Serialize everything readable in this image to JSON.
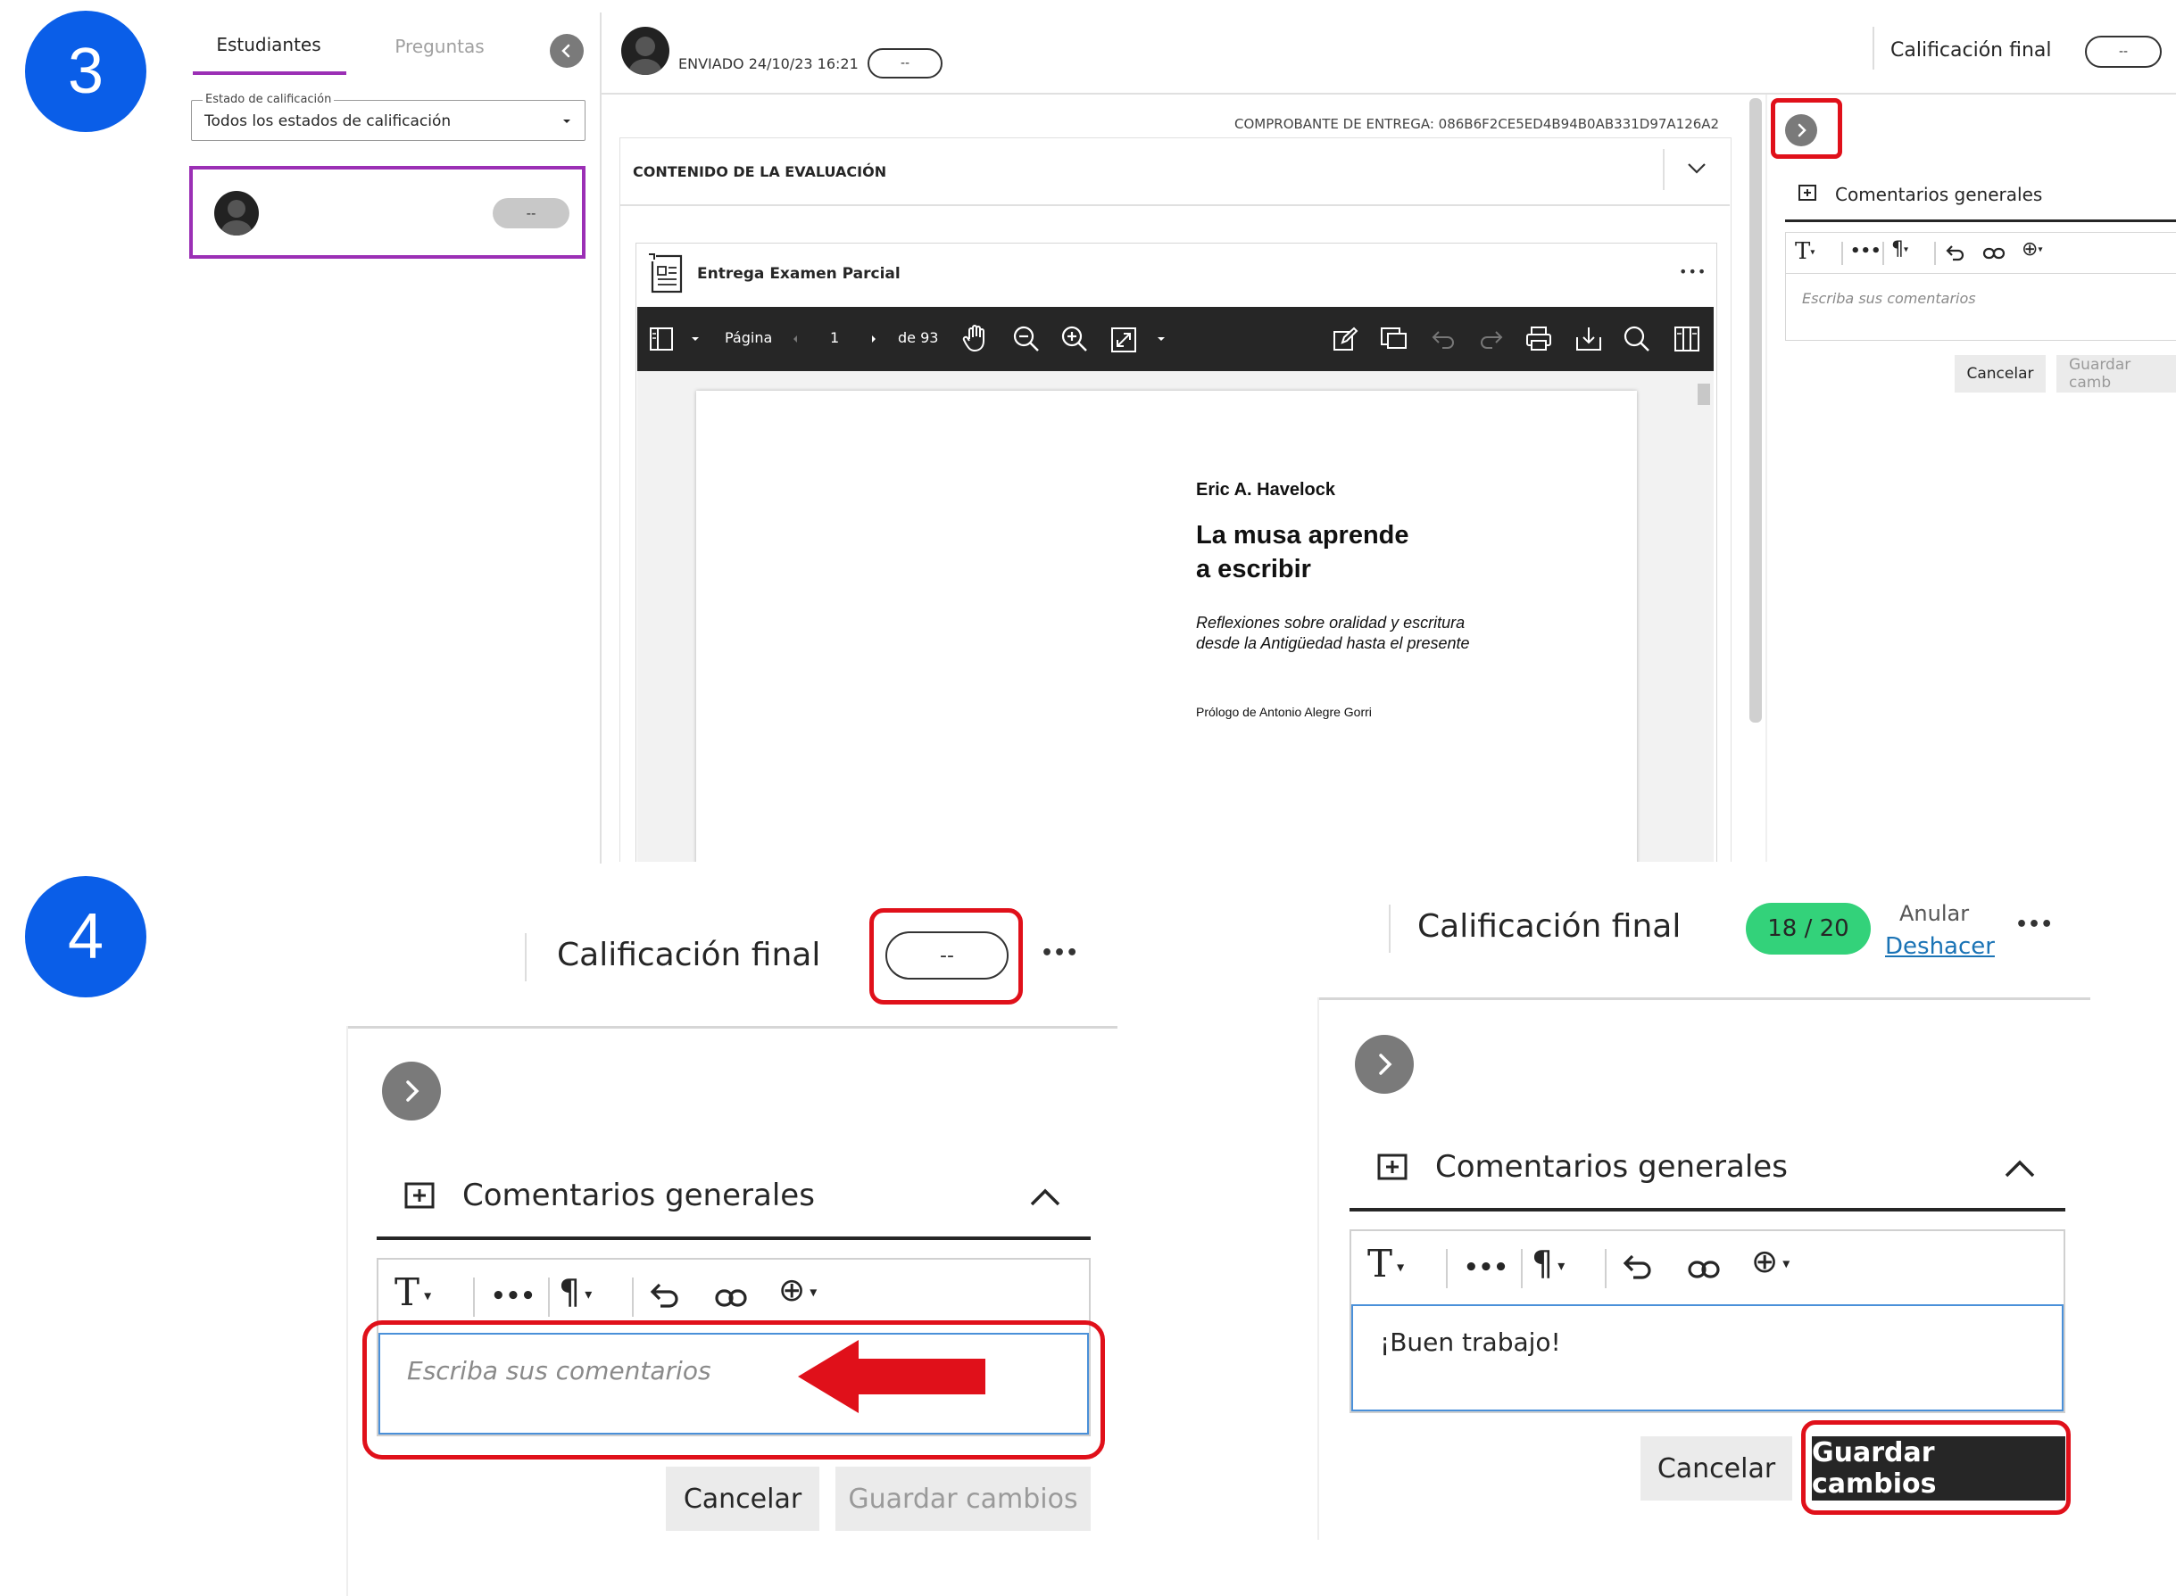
{
  "steps": {
    "step3": "3",
    "step4": "4"
  },
  "colors": {
    "accent_purple": "#9b2fb5",
    "highlight_red": "#e0101a",
    "step_blue": "#0a5ee8",
    "grade_green": "#33d27a"
  },
  "left_panel": {
    "tab_students": "Estudiantes",
    "tab_questions": "Preguntas",
    "filter_legend": "Estado de calificación",
    "filter_value": "Todos los estados de calificación",
    "student_grade": "--"
  },
  "submission_header": {
    "sent_label": "ENVIADO 24/10/23 16:21",
    "attempt_grade": "--"
  },
  "final_grade_header": {
    "label": "Calificación final",
    "value": "--"
  },
  "receipt": "COMPROBANTE DE ENTREGA: 086B6F2CE5ED4B94B0AB331D97A126A2",
  "assessment_content": {
    "section_title": "CONTENIDO DE LA EVALUACIÓN",
    "file_title": "Entrega Examen Parcial",
    "more_label": "•••"
  },
  "pdf_toolbar": {
    "page_label": "Página",
    "page_number": "1",
    "page_total": "de 93"
  },
  "document": {
    "author": "Eric A. Havelock",
    "title_line1": "La musa aprende",
    "title_line2": "a escribir",
    "subtitle_line1": "Reflexiones sobre oralidad y escritura",
    "subtitle_line2": "desde la Antigüedad hasta el presente",
    "prologue": "Prólogo de Antonio Alegre Gorri"
  },
  "feedback_small": {
    "section_title": "Comentarios generales",
    "placeholder": "Escriba sus comentarios",
    "cancel": "Cancelar",
    "save": "Guardar camb"
  },
  "step4_left": {
    "final_grade_label": "Calificación final",
    "grade_value": "--",
    "more_label": "•••",
    "section_title": "Comentarios generales",
    "placeholder": "Escriba sus comentarios",
    "cancel": "Cancelar",
    "save": "Guardar cambios"
  },
  "step4_right": {
    "final_grade_label": "Calificación final",
    "grade_value": "18 / 20",
    "override_label": "Anular",
    "undo_label": "Deshacer",
    "more_label": "•••",
    "section_title": "Comentarios generales",
    "comment_text": "¡Buen trabajo!",
    "cancel": "Cancelar",
    "save": "Guardar cambios"
  },
  "icons": [
    "chevron-left-icon",
    "chevron-right-icon",
    "chevron-down-icon",
    "chevron-up-icon",
    "avatar-icon",
    "document-icon",
    "sidebar-toggle-icon",
    "hand-icon",
    "zoom-out-icon",
    "zoom-in-icon",
    "fullscreen-icon",
    "annotate-icon",
    "comment-icon",
    "undo-icon",
    "redo-icon",
    "print-icon",
    "download-icon",
    "search-icon",
    "columns-icon",
    "add-comment-icon",
    "text-format-icon",
    "paragraph-icon",
    "link-icon",
    "plus-circle-icon",
    "arrow-left-icon"
  ]
}
